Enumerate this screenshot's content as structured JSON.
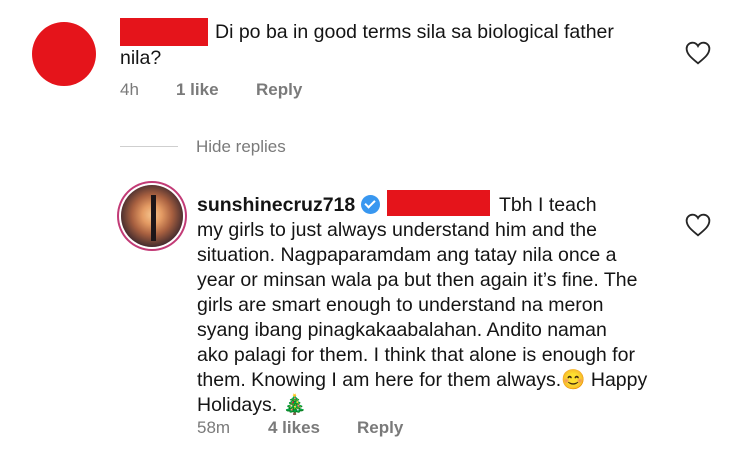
{
  "comment": {
    "text_line1": "Di po ba in good terms  sila sa biological father",
    "text_line2": "nila?",
    "time": "4h",
    "likes": "1 like",
    "reply": "Reply"
  },
  "thread": {
    "hide_replies": "Hide replies"
  },
  "reply_comment": {
    "username": "sunshinecruz718",
    "first_line_tail": "Tbh I teach",
    "lines": [
      "my girls to just always understand him and the",
      "situation. Nagpaparamdam ang tatay nila once a",
      "year or minsan wala pa but then again it’s fine. The",
      "girls are smart enough to understand na meron",
      "syang ibang pinagkakaabalahan. Andito naman",
      "ako palagi for them. I think that alone is enough for",
      "them. Knowing I am here for them always.😊 Happy",
      "Holidays. 🎄"
    ],
    "time": "58m",
    "likes": "4 likes",
    "reply": "Reply"
  },
  "icons": {
    "heart": "heart-outline-icon",
    "verified": "verified-badge-icon"
  },
  "colors": {
    "redaction": "#e5141b",
    "verified": "#3897f0",
    "meta": "#7a7a7a"
  }
}
